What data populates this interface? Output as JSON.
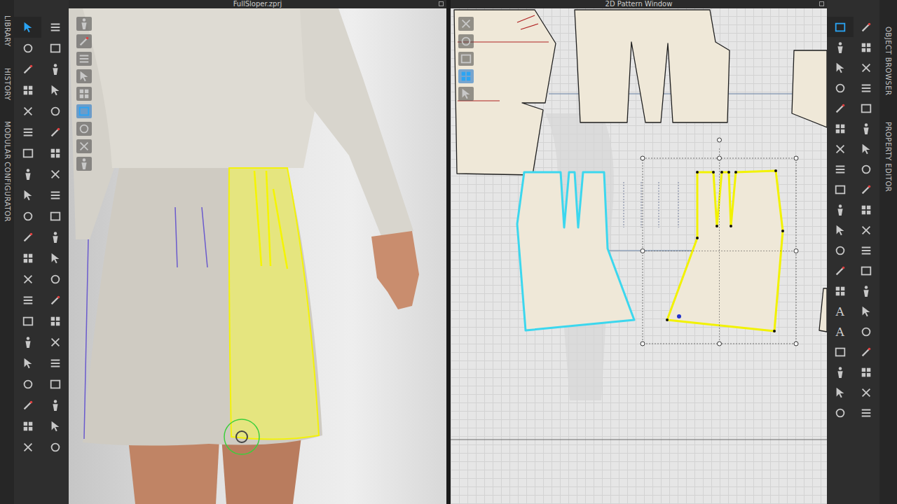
{
  "left_tabs": [
    "LIBRARY",
    "HISTORY",
    "MODULAR CONFIGURATOR"
  ],
  "right_tabs": [
    "OBJECT BROWSER",
    "PROPERTY EDITOR"
  ],
  "left_toolbar": [
    {
      "kind": "icon",
      "selected": true
    },
    {
      "kind": "icon",
      "selected": false
    },
    {
      "kind": "icon",
      "selected": false
    },
    {
      "kind": "icon",
      "selected": false
    },
    {
      "kind": "icon",
      "selected": false
    },
    {
      "kind": "icon",
      "selected": false
    },
    {
      "kind": "icon",
      "selected": false
    },
    {
      "kind": "icon",
      "selected": false
    },
    {
      "kind": "icon",
      "selected": false
    },
    {
      "kind": "icon",
      "selected": false
    },
    {
      "kind": "icon",
      "selected": false
    },
    {
      "kind": "icon",
      "selected": false
    },
    {
      "kind": "icon",
      "selected": false
    },
    {
      "kind": "icon",
      "selected": false
    },
    {
      "kind": "icon",
      "selected": false
    },
    {
      "kind": "icon",
      "selected": false
    },
    {
      "kind": "icon",
      "selected": false
    },
    {
      "kind": "icon",
      "selected": false
    },
    {
      "kind": "icon",
      "selected": false
    },
    {
      "kind": "icon",
      "selected": false
    },
    {
      "kind": "icon",
      "selected": false
    },
    {
      "kind": "icon",
      "selected": false
    },
    {
      "kind": "icon",
      "selected": false
    },
    {
      "kind": "icon",
      "selected": false
    },
    {
      "kind": "icon",
      "selected": false
    },
    {
      "kind": "icon",
      "selected": false
    },
    {
      "kind": "icon",
      "selected": false
    },
    {
      "kind": "icon",
      "selected": false
    },
    {
      "kind": "icon",
      "selected": false
    },
    {
      "kind": "icon",
      "selected": false
    },
    {
      "kind": "icon",
      "selected": false
    },
    {
      "kind": "icon",
      "selected": false
    },
    {
      "kind": "icon",
      "selected": false
    },
    {
      "kind": "icon",
      "selected": false
    },
    {
      "kind": "icon",
      "selected": false
    },
    {
      "kind": "icon",
      "selected": false
    },
    {
      "kind": "icon",
      "selected": false
    },
    {
      "kind": "icon",
      "selected": false
    },
    {
      "kind": "icon",
      "selected": false
    },
    {
      "kind": "icon",
      "selected": false
    },
    {
      "kind": "icon",
      "selected": false
    },
    {
      "kind": "icon",
      "selected": false
    }
  ],
  "right_toolbar": [
    {
      "kind": "icon",
      "selected": true
    },
    {
      "kind": "icon",
      "selected": false
    },
    {
      "kind": "icon",
      "selected": false
    },
    {
      "kind": "icon",
      "selected": false
    },
    {
      "kind": "icon",
      "selected": false
    },
    {
      "kind": "icon",
      "selected": false
    },
    {
      "kind": "icon",
      "selected": false
    },
    {
      "kind": "icon",
      "selected": false
    },
    {
      "kind": "icon",
      "selected": false
    },
    {
      "kind": "icon",
      "selected": false
    },
    {
      "kind": "icon",
      "selected": false
    },
    {
      "kind": "icon",
      "selected": false
    },
    {
      "kind": "icon",
      "selected": false
    },
    {
      "kind": "icon",
      "selected": false
    },
    {
      "kind": "icon",
      "selected": false
    },
    {
      "kind": "icon",
      "selected": false
    },
    {
      "kind": "icon",
      "selected": false
    },
    {
      "kind": "icon",
      "selected": false
    },
    {
      "kind": "icon",
      "selected": false
    },
    {
      "kind": "icon",
      "selected": false
    },
    {
      "kind": "icon",
      "selected": false
    },
    {
      "kind": "icon",
      "selected": false
    },
    {
      "kind": "icon",
      "selected": false
    },
    {
      "kind": "icon",
      "selected": false
    },
    {
      "kind": "icon",
      "selected": false
    },
    {
      "kind": "icon",
      "selected": false
    },
    {
      "kind": "icon",
      "selected": false
    },
    {
      "kind": "icon",
      "selected": false
    },
    {
      "kind": "text",
      "label": "A",
      "selected": false
    },
    {
      "kind": "icon",
      "selected": false
    },
    {
      "kind": "text",
      "label": "A",
      "selected": false
    },
    {
      "kind": "icon",
      "selected": false
    },
    {
      "kind": "icon",
      "selected": false
    },
    {
      "kind": "icon",
      "selected": false
    },
    {
      "kind": "icon",
      "selected": false
    },
    {
      "kind": "icon",
      "selected": false
    },
    {
      "kind": "icon",
      "selected": false
    },
    {
      "kind": "icon",
      "selected": false
    },
    {
      "kind": "icon",
      "selected": false
    },
    {
      "kind": "icon",
      "selected": false
    }
  ],
  "scene_3d": {
    "title": "FullSloper.zprj",
    "panel_highlighted": true,
    "mini_toolbar": [
      {
        "selected": false
      },
      {
        "selected": false
      },
      {
        "selected": false
      },
      {
        "selected": false
      },
      {
        "selected": false
      },
      {
        "selected": true
      },
      {
        "selected": false
      },
      {
        "selected": false
      },
      {
        "selected": false
      }
    ]
  },
  "pattern_window": {
    "title": "2D Pattern Window",
    "mini_toolbar": [
      {
        "selected": false
      },
      {
        "selected": false
      },
      {
        "selected": false
      },
      {
        "selected": true
      },
      {
        "selected": false
      }
    ],
    "pieces": [
      {
        "state": "normal"
      },
      {
        "state": "normal"
      },
      {
        "state": "normal"
      },
      {
        "state": "normal"
      },
      {
        "state": "selected"
      },
      {
        "state": "active"
      }
    ]
  }
}
